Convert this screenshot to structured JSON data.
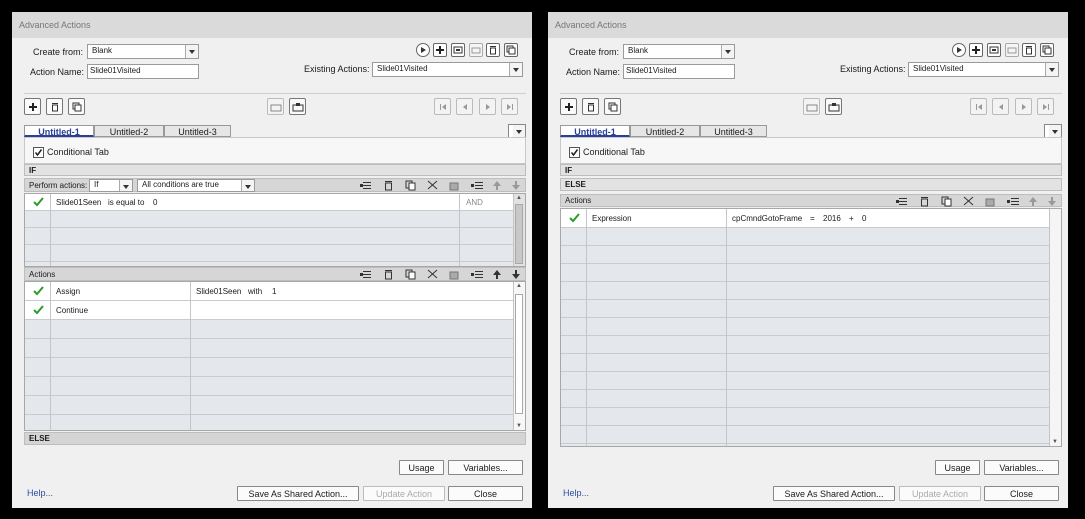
{
  "dialogs": [
    {
      "title": "Advanced Actions",
      "create_from_label": "Create from:",
      "create_from_value": "Blank",
      "action_name_label": "Action Name:",
      "action_name_value": "Slide01Visited",
      "existing_actions_label": "Existing Actions:",
      "existing_actions_value": "Slide01Visited",
      "tabs": [
        "Untitled-1",
        "Untitled-2",
        "Untitled-3"
      ],
      "conditional_tab_label": "Conditional Tab",
      "conditional_tab_checked": true,
      "if_label": "IF",
      "perform_actions_label": "Perform actions:",
      "perform_actions_value": "If",
      "conditions_value": "All conditions are true",
      "conditions": [
        {
          "status": "valid",
          "variable": "Slide01Seen",
          "operator": "is equal to",
          "value": "0",
          "logic": "AND"
        }
      ],
      "actions_label": "Actions",
      "actions": [
        {
          "status": "valid",
          "action": "Assign",
          "target": "Slide01Seen",
          "keyword": "with",
          "value": "1"
        },
        {
          "status": "valid",
          "action": "Continue",
          "target": "",
          "keyword": "",
          "value": ""
        }
      ],
      "else_label": "ELSE",
      "buttons": {
        "usage": "Usage",
        "variables": "Variables...",
        "save_shared": "Save As Shared Action...",
        "update": "Update Action",
        "close": "Close"
      },
      "help": "Help..."
    },
    {
      "title": "Advanced Actions",
      "create_from_label": "Create from:",
      "create_from_value": "Blank",
      "action_name_label": "Action Name:",
      "action_name_value": "Slide01Visited",
      "existing_actions_label": "Existing Actions:",
      "existing_actions_value": "Slide01Visited",
      "tabs": [
        "Untitled-1",
        "Untitled-2",
        "Untitled-3"
      ],
      "conditional_tab_label": "Conditional Tab",
      "conditional_tab_checked": true,
      "if_label": "IF",
      "else_label": "ELSE",
      "actions_label": "Actions",
      "actions": [
        {
          "status": "valid",
          "action": "Expression",
          "var": "cpCmndGotoFrame",
          "eq": "=",
          "val1": "2016",
          "op": "+",
          "val2": "0"
        }
      ],
      "buttons": {
        "usage": "Usage",
        "variables": "Variables...",
        "save_shared": "Save As Shared Action...",
        "update": "Update Action",
        "close": "Close"
      },
      "help": "Help..."
    }
  ],
  "colors": {
    "active_tab": "#2b3f94",
    "link": "#2b4ea0",
    "check": "#2e9a2e",
    "disabled_text": "#aaaaaa"
  }
}
